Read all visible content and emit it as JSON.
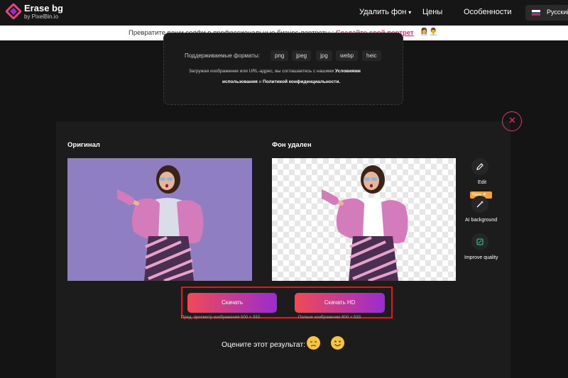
{
  "nav": {
    "brand": "Erase bg",
    "brand_sub": "by PixelBin.io",
    "links": [
      "Удалить фон",
      "Цены",
      "Особенности"
    ],
    "language": "Русский"
  },
  "promo": {
    "text": "Превратите ваши селфи в профессиональные бизнес-портреты",
    "link": "Создайте свой портрет"
  },
  "upload": {
    "formats_label": "Поддерживаемые форматы:",
    "formats": [
      "png",
      "jpeg",
      "jpg",
      "webp",
      "heic"
    ],
    "terms_prefix": "Загружая изображение или URL-адрес, вы соглашаетесь с нашими",
    "terms_link": "Условиями",
    "terms_link2": "использования",
    "terms_and": "и",
    "privacy_link": "Политикой конфиденциальности."
  },
  "result": {
    "original_title": "Оригинал",
    "removed_title": "Фон удален",
    "tools": [
      {
        "label": "Edit",
        "icon": "pencil-icon"
      },
      {
        "label": "AI background",
        "icon": "magic-wand-icon",
        "badge": "New ✦"
      },
      {
        "label": "Improve quality",
        "icon": "enhance-icon"
      }
    ],
    "download_label": "Скачать",
    "download_hd_label": "Скачать HD",
    "download_note": "Пред. просмотр изображения 500 × 333",
    "download_hd_note": "Полное изображение 800 × 533",
    "rate_label": "Оцените этот результат:",
    "rate_options": [
      "sad-face-icon",
      "happy-face-icon"
    ]
  },
  "colors": {
    "accent": "#d63a6a",
    "button_start": "#f04a55",
    "button_end": "#9a2cd0",
    "highlight": "#d61c1c"
  }
}
